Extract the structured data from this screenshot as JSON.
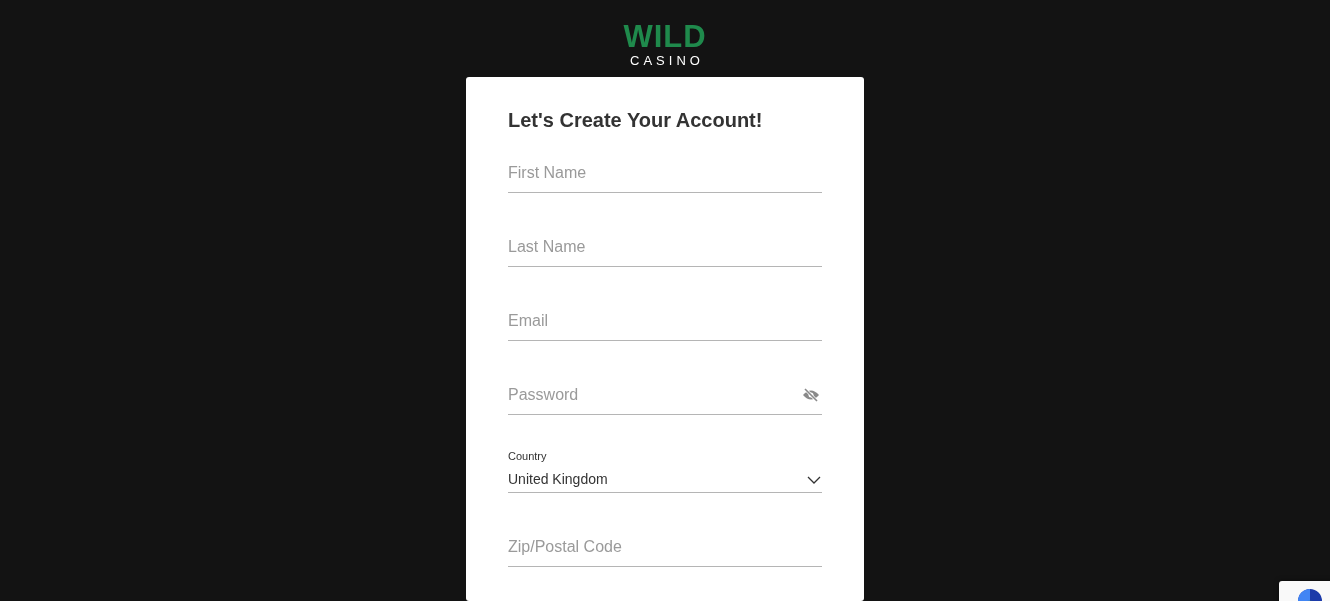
{
  "logo": {
    "word": "WILD",
    "subword": "CASINO"
  },
  "form": {
    "title": "Let's Create Your Account!",
    "fields": [
      {
        "kind": "text",
        "placeholder": "First Name"
      },
      {
        "kind": "text",
        "placeholder": "Last Name"
      },
      {
        "kind": "text",
        "placeholder": "Email"
      },
      {
        "kind": "password",
        "placeholder": "Password"
      },
      {
        "kind": "select",
        "label": "Country",
        "value": "United Kingdom"
      },
      {
        "kind": "text",
        "placeholder": "Zip/Postal Code"
      }
    ]
  }
}
